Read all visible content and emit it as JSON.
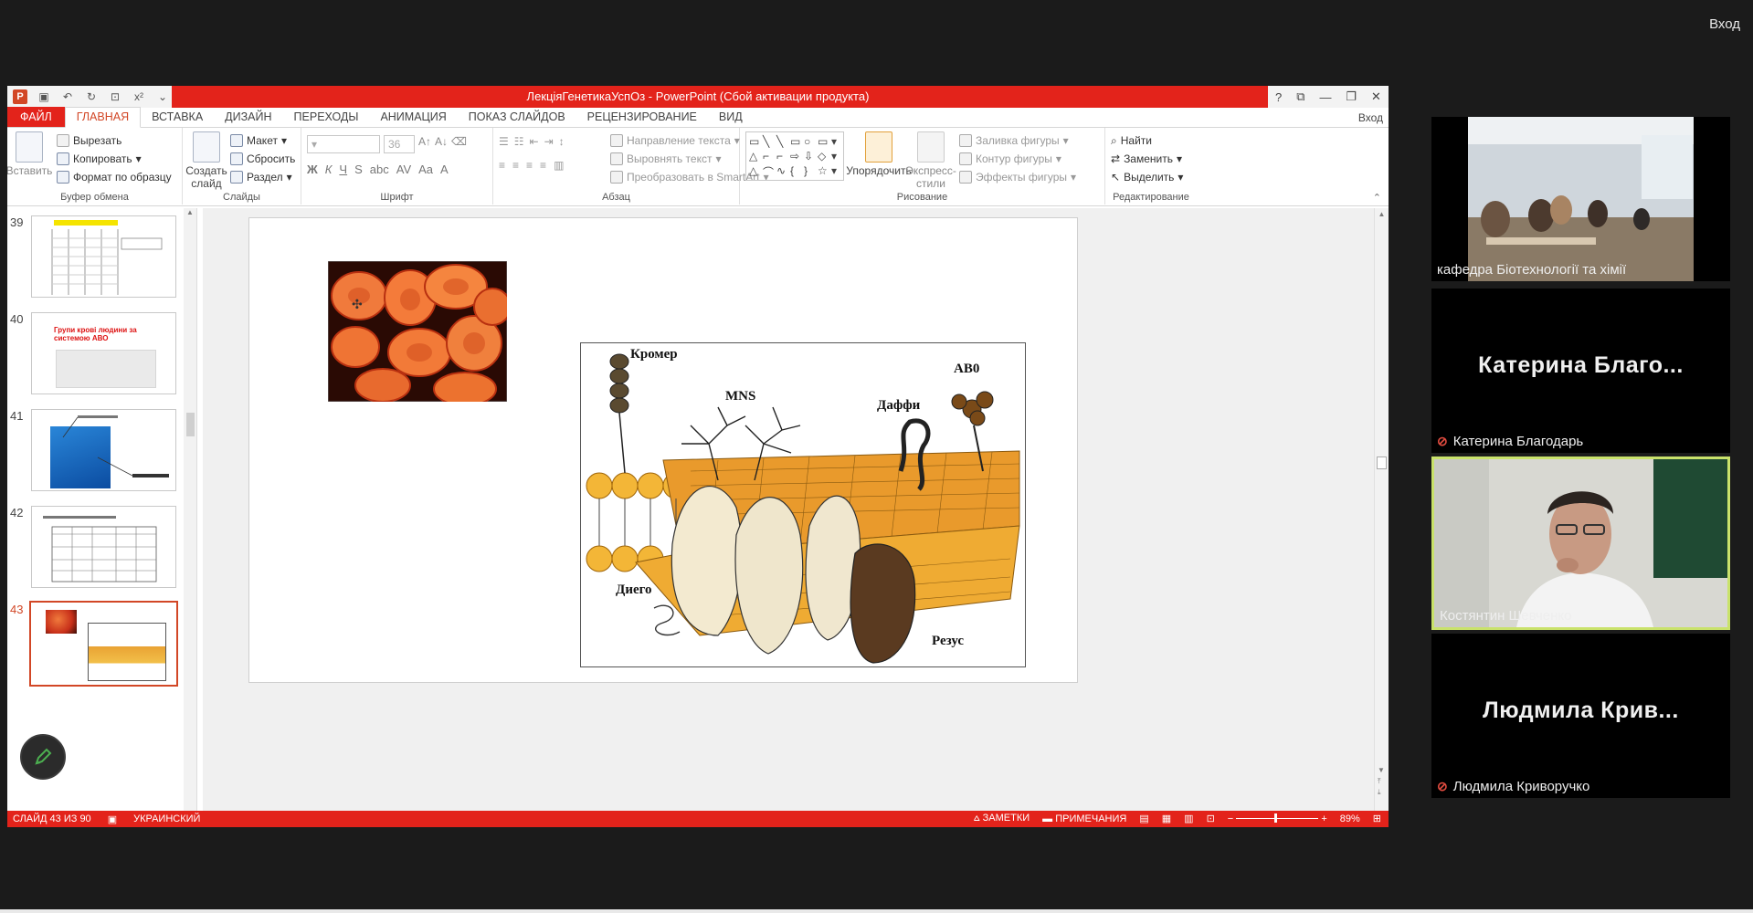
{
  "meeting": {
    "login_label": "Вход"
  },
  "window": {
    "title": "ЛекціяГенетикаУспОз  -  PowerPoint (Сбой активации продукта)",
    "controls": [
      "?",
      "⧉",
      "—",
      "❐",
      "✕"
    ]
  },
  "ribbon_tabs": [
    {
      "label": "ФАЙЛ",
      "kind": "file"
    },
    {
      "label": "ГЛАВНАЯ",
      "kind": "active"
    },
    {
      "label": "ВСТАВКА",
      "kind": ""
    },
    {
      "label": "ДИЗАЙН",
      "kind": ""
    },
    {
      "label": "ПЕРЕХОДЫ",
      "kind": ""
    },
    {
      "label": "АНИМАЦИЯ",
      "kind": ""
    },
    {
      "label": "ПОКАЗ СЛАЙДОВ",
      "kind": ""
    },
    {
      "label": "РЕЦЕНЗИРОВАНИЕ",
      "kind": ""
    },
    {
      "label": "ВИД",
      "kind": ""
    }
  ],
  "ribbon_login": "Вход",
  "ribbon": {
    "clipboard": {
      "paste": "Вставить",
      "cut": "Вырезать",
      "copy": "Копировать",
      "format_painter": "Формат по образцу",
      "label": "Буфер обмена"
    },
    "slides": {
      "new_slide_1": "Создать",
      "new_slide_2": "слайд",
      "layout": "Макет",
      "reset": "Сбросить",
      "section": "Раздел",
      "label": "Слайды"
    },
    "font": {
      "size": "36",
      "label": "Шрифт"
    },
    "paragraph": {
      "text_direction": "Направление текста",
      "align_text": "Выровнять текст",
      "convert_smartart": "Преобразовать в SmartArt",
      "label": "Абзац"
    },
    "drawing": {
      "arrange": "Упорядочить",
      "quick_styles_1": "Экспресс-",
      "quick_styles_2": "стили",
      "shape_fill": "Заливка фигуры",
      "shape_outline": "Контур фигуры",
      "shape_effects": "Эффекты фигуры",
      "label": "Рисование"
    },
    "editing": {
      "find": "Найти",
      "replace": "Заменить",
      "select": "Выделить",
      "label": "Редактирование"
    }
  },
  "thumbnails": [
    {
      "num": "39",
      "title": "",
      "current": false
    },
    {
      "num": "40",
      "title": "Групи крові людини за системою АВО",
      "current": false
    },
    {
      "num": "41",
      "title": "",
      "current": false
    },
    {
      "num": "42",
      "title": "",
      "current": false
    },
    {
      "num": "43",
      "title": "",
      "current": true
    }
  ],
  "slide": {
    "labels": {
      "kromer": "Кромер",
      "mns": "MNS",
      "abo": "АВ0",
      "duffy": "Даффи",
      "diego": "Диего",
      "rhesus": "Резус"
    }
  },
  "status": {
    "slide_counter": "СЛАЙД 43 ИЗ 90",
    "language": "УКРАИНСКИЙ",
    "notes": "ЗАМЕТКИ",
    "comments": "ПРИМЕЧАНИЯ",
    "zoom": "89%"
  },
  "participants": [
    {
      "name": "кафедра Біотехнології та хімії",
      "big": "",
      "muted": false,
      "video": "classroom"
    },
    {
      "name": "Катерина Благодарь",
      "big": "Катерина  Благо...",
      "muted": true,
      "video": ""
    },
    {
      "name": "Костянтин Шевченко",
      "big": "",
      "muted": false,
      "video": "speaker"
    },
    {
      "name": "Людмила Криворучко",
      "big": "Людмила  Крив...",
      "muted": true,
      "video": ""
    }
  ]
}
